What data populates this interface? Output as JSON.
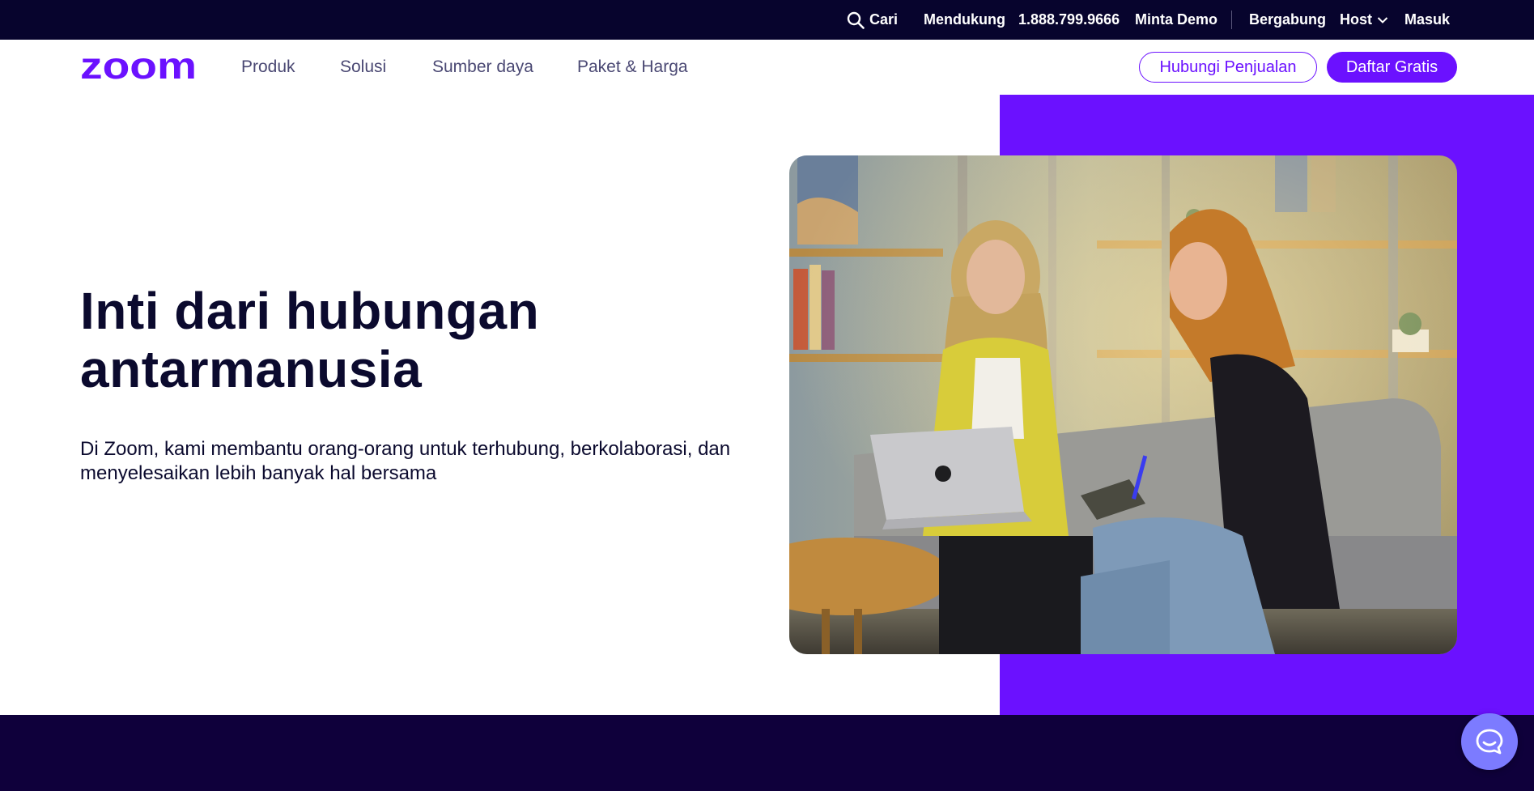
{
  "utility_bar": {
    "search_label": "Cari",
    "support_label": "Mendukung",
    "phone": "1.888.799.9666",
    "demo_label": "Minta Demo",
    "join_label": "Bergabung",
    "host_label": "Host",
    "signin_label": "Masuk"
  },
  "nav": {
    "logo_text": "zoom",
    "links": [
      "Produk",
      "Solusi",
      "Sumber daya",
      "Paket & Harga"
    ],
    "contact_sales_label": "Hubungi Penjualan",
    "signup_label": "Daftar Gratis"
  },
  "hero": {
    "title": "Inti dari hubungan antarmanusia",
    "subtitle": "Di Zoom, kami membantu orang-orang untuk terhubung, berkolaborasi, dan menyelesaikan lebih banyak hal bersama"
  },
  "colors": {
    "brand": "#6b11ff",
    "utility_bg": "#07042d",
    "footer_bg": "#0f003b",
    "chat_button": "#7c7bff",
    "heading": "#0b0a2e"
  },
  "icons": {
    "search": "search-icon",
    "host_dropdown": "chevron-down-icon",
    "chat": "chat-bubble-icon"
  }
}
